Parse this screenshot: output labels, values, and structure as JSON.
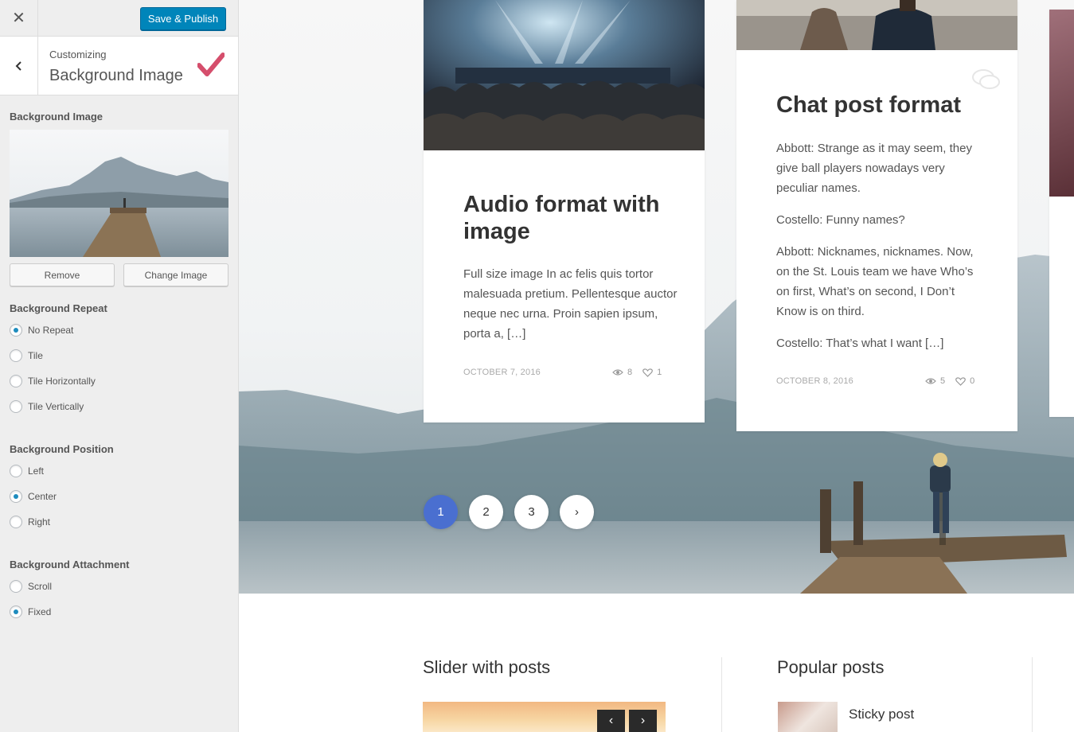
{
  "topbar": {
    "save_label": "Save & Publish"
  },
  "section": {
    "breadcrumb": "Customizing",
    "title": "Background Image"
  },
  "controls": {
    "bg_image_label": "Background Image",
    "remove_label": "Remove",
    "change_label": "Change Image",
    "repeat": {
      "label": "Background Repeat",
      "options": [
        "No Repeat",
        "Tile",
        "Tile Horizontally",
        "Tile Vertically"
      ],
      "selected": "No Repeat"
    },
    "position": {
      "label": "Background Position",
      "options": [
        "Left",
        "Center",
        "Right"
      ],
      "selected": "Center"
    },
    "attachment": {
      "label": "Background Attachment",
      "options": [
        "Scroll",
        "Fixed"
      ],
      "selected": "Fixed"
    }
  },
  "posts": [
    {
      "title": "Audio format with image",
      "excerpt": [
        "Full size image In ac felis quis tortor malesuada pretium. Pellentesque auctor neque nec urna. Proin sapien ipsum, porta a, […]"
      ],
      "date": "OCTOBER 7, 2016",
      "views": "8",
      "likes": "1"
    },
    {
      "title": "Chat post format",
      "excerpt": [
        "Abbott: Strange as it may seem, they give ball players nowadays very peculiar names.",
        "Costello: Funny names?",
        "Abbott: Nicknames, nicknames. Now, on the St. Louis team we have Who’s on first, What’s on second, I Don’t Know is on third.",
        "Costello: That’s what I want […]"
      ],
      "date": "OCTOBER 8, 2016",
      "views": "5",
      "likes": "0"
    }
  ],
  "pagination": {
    "pages": [
      "1",
      "2",
      "3"
    ],
    "current": "1",
    "next": "›"
  },
  "widgets": {
    "slider_title": "Slider with posts",
    "popular_title": "Popular posts",
    "popular_first": "Sticky post",
    "slider_prev": "‹",
    "slider_next": "›"
  },
  "colors": {
    "accent": "#0085ba",
    "pager_active": "#4a6fd0",
    "check": "#d54e6c"
  },
  "icons": [
    "close-icon",
    "back-chevron-icon",
    "checkmark-icon",
    "chat-bubble-icon",
    "eye-icon",
    "heart-icon"
  ]
}
